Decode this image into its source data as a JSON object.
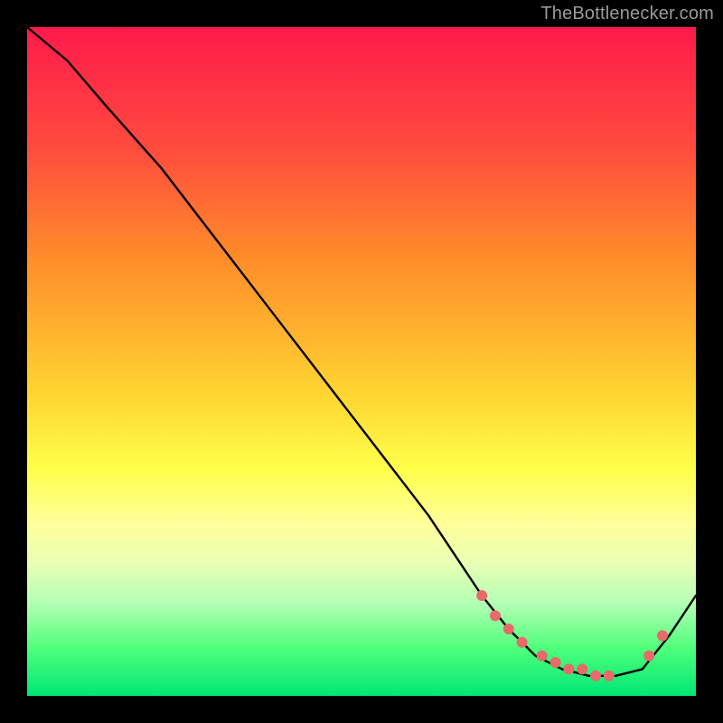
{
  "attribution": "TheBottlenecker.com",
  "chart_data": {
    "type": "line",
    "title": "",
    "xlabel": "",
    "ylabel": "",
    "xlim": [
      0,
      100
    ],
    "ylim": [
      0,
      100
    ],
    "series": [
      {
        "name": "curve",
        "x": [
          0,
          6,
          12,
          20,
          30,
          40,
          50,
          60,
          68,
          72,
          76,
          80,
          84,
          88,
          92,
          96,
          100
        ],
        "y": [
          100,
          95,
          88,
          79,
          66,
          53,
          40,
          27,
          15,
          10,
          6,
          4,
          3,
          3,
          4,
          9,
          15
        ]
      }
    ],
    "markers": {
      "name": "dots",
      "x": [
        68,
        70,
        72,
        74,
        77,
        79,
        81,
        83,
        85,
        87,
        93,
        95
      ],
      "y": [
        15,
        12,
        10,
        8,
        6,
        5,
        4,
        4,
        3,
        3,
        6,
        9
      ]
    },
    "gradient_stops": [
      {
        "pos": 0,
        "color": "#ff1a4b"
      },
      {
        "pos": 18,
        "color": "#ff4b3e"
      },
      {
        "pos": 34,
        "color": "#ff8a2a"
      },
      {
        "pos": 55,
        "color": "#ffd531"
      },
      {
        "pos": 66,
        "color": "#ffff4a"
      },
      {
        "pos": 74,
        "color": "#ffff99"
      },
      {
        "pos": 80,
        "color": "#e9ffb3"
      },
      {
        "pos": 86,
        "color": "#b6ffb6"
      },
      {
        "pos": 93,
        "color": "#4dff7a"
      },
      {
        "pos": 100,
        "color": "#00e676"
      }
    ],
    "marker_color": "#e86a6a",
    "line_color": "#000000"
  }
}
